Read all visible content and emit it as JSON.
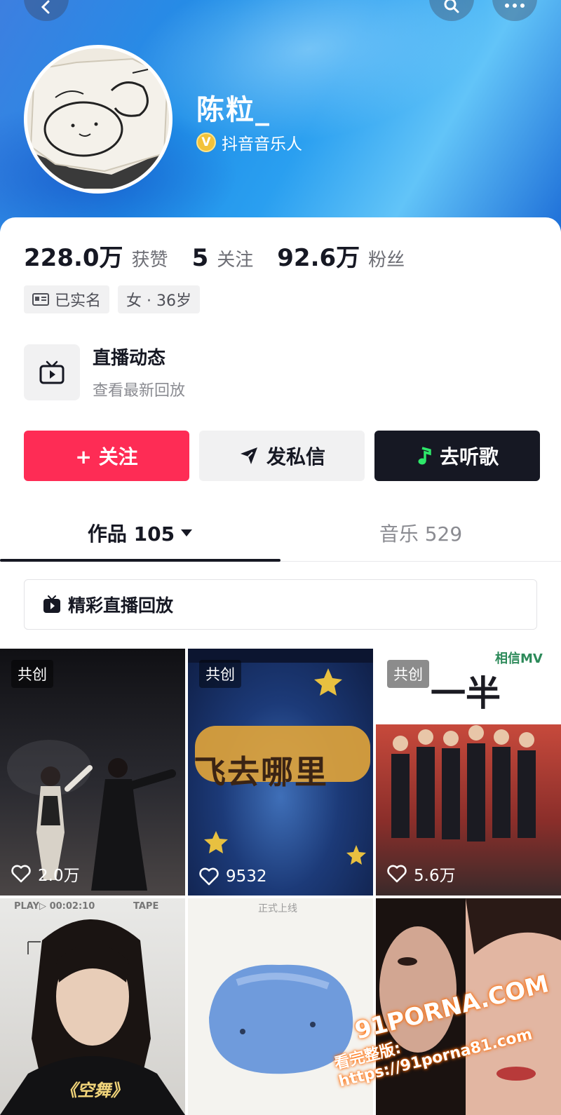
{
  "profile": {
    "name": "陈粒_",
    "verify_label": "抖音音乐人",
    "verify_badge": "V"
  },
  "stats": [
    {
      "value": "228.0万",
      "label": "获赞"
    },
    {
      "value": "5",
      "label": "关注"
    },
    {
      "value": "92.6万",
      "label": "粉丝"
    }
  ],
  "tags": [
    {
      "icon": "id-card-icon",
      "label": "已实名"
    },
    {
      "label": "女 · 36岁"
    }
  ],
  "live": {
    "title": "直播动态",
    "subtitle": "查看最新回放"
  },
  "actions": {
    "follow": "+ 关注",
    "message": "发私信",
    "music": "去听歌"
  },
  "tabs": [
    {
      "label": "作品 105",
      "active": true
    },
    {
      "label": "音乐 529",
      "active": false
    }
  ],
  "replay": {
    "label": "精彩直播回放"
  },
  "videos": [
    {
      "badge": "共创",
      "likes": "2.0万"
    },
    {
      "badge": "共创",
      "likes": "9532",
      "art": "飞去哪里"
    },
    {
      "badge": "共创",
      "likes": "5.6万",
      "art": "一半",
      "art_top": "相信MV"
    },
    {
      "art_top": "PLAY▷ 00:02:10",
      "art_tape": "TAPE",
      "art": "《空舞》"
    },
    {
      "art_top": "正式上线"
    },
    {}
  ],
  "watermark": {
    "line1": "91PORNA.COM",
    "line2": "看完整版: https://91porna81.com"
  },
  "colors": {
    "accent": "#fe2c55",
    "dark": "#161823",
    "banner": "#1f8fe8"
  }
}
